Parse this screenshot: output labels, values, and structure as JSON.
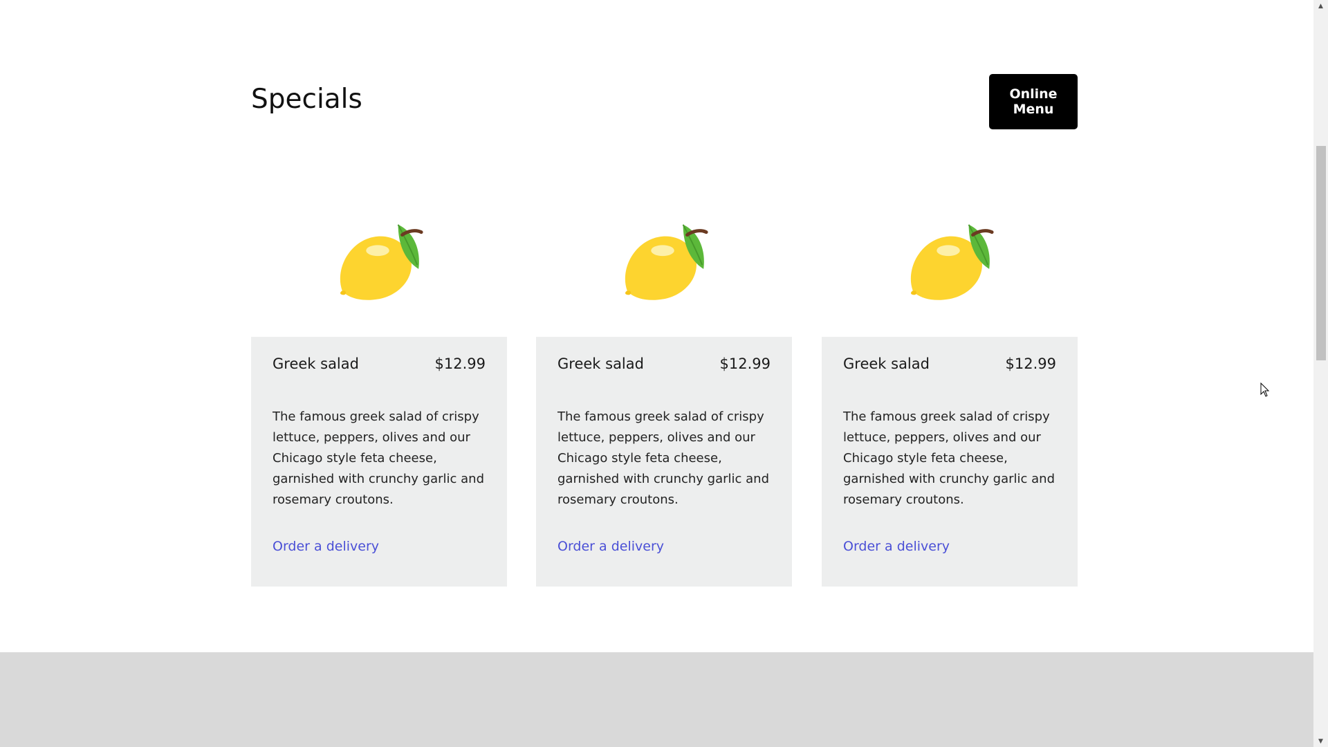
{
  "header": {
    "title": "Specials",
    "menu_button_label": "Online Menu"
  },
  "cards": [
    {
      "image_icon": "lemon-icon",
      "name": "Greek salad",
      "price": "$12.99",
      "description": "The famous greek salad of crispy lettuce, peppers, olives and our Chicago style feta cheese, garnished with crunchy garlic and rosemary croutons.",
      "link_label": "Order a delivery"
    },
    {
      "image_icon": "lemon-icon",
      "name": "Greek salad",
      "price": "$12.99",
      "description": "The famous greek salad of crispy lettuce, peppers, olives and our Chicago style feta cheese, garnished with crunchy garlic and rosemary croutons.",
      "link_label": "Order a delivery"
    },
    {
      "image_icon": "lemon-icon",
      "name": "Greek salad",
      "price": "$12.99",
      "description": "The famous greek salad of crispy lettuce, peppers, olives and our Chicago style feta cheese, garnished with crunchy garlic and rosemary croutons.",
      "link_label": "Order a delivery"
    }
  ],
  "colors": {
    "button_bg": "#000000",
    "card_bg": "#edeeee",
    "link": "#4a4fd6",
    "footer_band": "#d9d9d9",
    "lemon": "#fdd42f",
    "leaf": "#5cb83a"
  },
  "scrollbar": {
    "up_icon": "scroll-up-arrow-icon",
    "down_icon": "scroll-down-arrow-icon"
  }
}
